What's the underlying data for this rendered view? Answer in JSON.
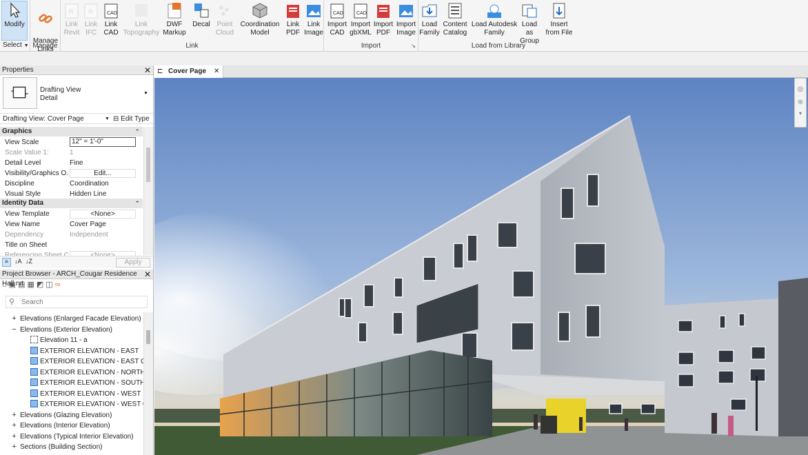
{
  "ribbon": {
    "select_group": {
      "modify": "Modify",
      "select": "Select"
    },
    "manage_group": {
      "manage_links": "Manage\nLinks",
      "label": "Manage"
    },
    "link_group": {
      "label": "Link",
      "tools": [
        {
          "label": "Link\nRevit",
          "disabled": true
        },
        {
          "label": "Link\nIFC",
          "disabled": true
        },
        {
          "label": "Link\nCAD",
          "disabled": false
        },
        {
          "label": "Link\nTopography",
          "disabled": true
        },
        {
          "label": "DWF\nMarkup",
          "disabled": false
        },
        {
          "label": "Decal",
          "disabled": false
        },
        {
          "label": "Point\nCloud",
          "disabled": true
        },
        {
          "label": "Coordination\nModel",
          "disabled": false
        },
        {
          "label": "Link\nPDF",
          "disabled": false
        },
        {
          "label": "Link\nImage",
          "disabled": false
        }
      ]
    },
    "import_group": {
      "label": "Import",
      "tools": [
        {
          "label": "Import\nCAD"
        },
        {
          "label": "Import\ngbXML"
        },
        {
          "label": "Import\nPDF"
        },
        {
          "label": "Import\nImage"
        }
      ]
    },
    "library_group": {
      "label": "Load from Library",
      "tools": [
        {
          "label": "Load\nFamily"
        },
        {
          "label": "Content\nCatalog"
        },
        {
          "label": "Load Autodesk\nFamily"
        },
        {
          "label": "Load as\nGroup"
        },
        {
          "label": "Insert\nfrom File"
        }
      ]
    }
  },
  "properties": {
    "title": "Properties",
    "type_line1": "Drafting View",
    "type_line2": "Detail",
    "selector": "Drafting View: Cover Page",
    "edit_type": "Edit Type",
    "graphics_header": "Graphics",
    "rows_graphics": [
      {
        "k": "View Scale",
        "v": "12\" = 1'-0\"",
        "dim": false
      },
      {
        "k": "Scale Value    1:",
        "v": "1",
        "dim": true
      },
      {
        "k": "Detail Level",
        "v": "Fine",
        "dim": false
      },
      {
        "k": "Visibility/Graphics O...",
        "v": "Edit...",
        "dim": false
      },
      {
        "k": "Discipline",
        "v": "Coordination",
        "dim": false
      },
      {
        "k": "Visual Style",
        "v": "Hidden Line",
        "dim": false
      }
    ],
    "identity_header": "Identity Data",
    "rows_identity": [
      {
        "k": "View Template",
        "v": "<None>",
        "dim": false
      },
      {
        "k": "View Name",
        "v": "Cover Page",
        "dim": false
      },
      {
        "k": "Dependency",
        "v": "Independent",
        "dim": true
      },
      {
        "k": "Title on Sheet",
        "v": "",
        "dim": false
      },
      {
        "k": "Referencing Sheet C...",
        "v": "<None>",
        "dim": true
      }
    ],
    "apply": "Apply"
  },
  "browser": {
    "title": "Project Browser - ARCH_Cougar Residence Hall.rvt",
    "search_placeholder": "Search",
    "items": [
      {
        "label": "Elevations (Enlarged Facade Elevation)",
        "level": 0,
        "expander": "+"
      },
      {
        "label": "Elevations (Exterior Elevation)",
        "level": 0,
        "expander": "−"
      },
      {
        "label": "Elevation 11 - a",
        "level": 1,
        "icon": "hollow"
      },
      {
        "label": "EXTERIOR ELEVATION - EAST",
        "level": 1,
        "icon": "view"
      },
      {
        "label": "EXTERIOR ELEVATION - EAST COURT",
        "level": 1,
        "icon": "view"
      },
      {
        "label": "EXTERIOR ELEVATION - NORTH",
        "level": 1,
        "icon": "view"
      },
      {
        "label": "EXTERIOR ELEVATION - SOUTH",
        "level": 1,
        "icon": "view"
      },
      {
        "label": "EXTERIOR ELEVATION - WEST",
        "level": 1,
        "icon": "view"
      },
      {
        "label": "EXTERIOR ELEVATION - WEST COURT",
        "level": 1,
        "icon": "view"
      },
      {
        "label": "Elevations (Glazing Elevation)",
        "level": 0,
        "expander": "+"
      },
      {
        "label": "Elevations (Interior Elevation)",
        "level": 0,
        "expander": "+"
      },
      {
        "label": "Elevations (Typical Interior Elevation)",
        "level": 0,
        "expander": "+"
      },
      {
        "label": "Sections (Building Section)",
        "level": 0,
        "expander": "+"
      }
    ]
  },
  "view": {
    "tab_label": "Cover Page"
  },
  "colors": {
    "accent": "#1e6fc8",
    "link_orange": "#e8742a",
    "selected": "#cfe3f7"
  }
}
